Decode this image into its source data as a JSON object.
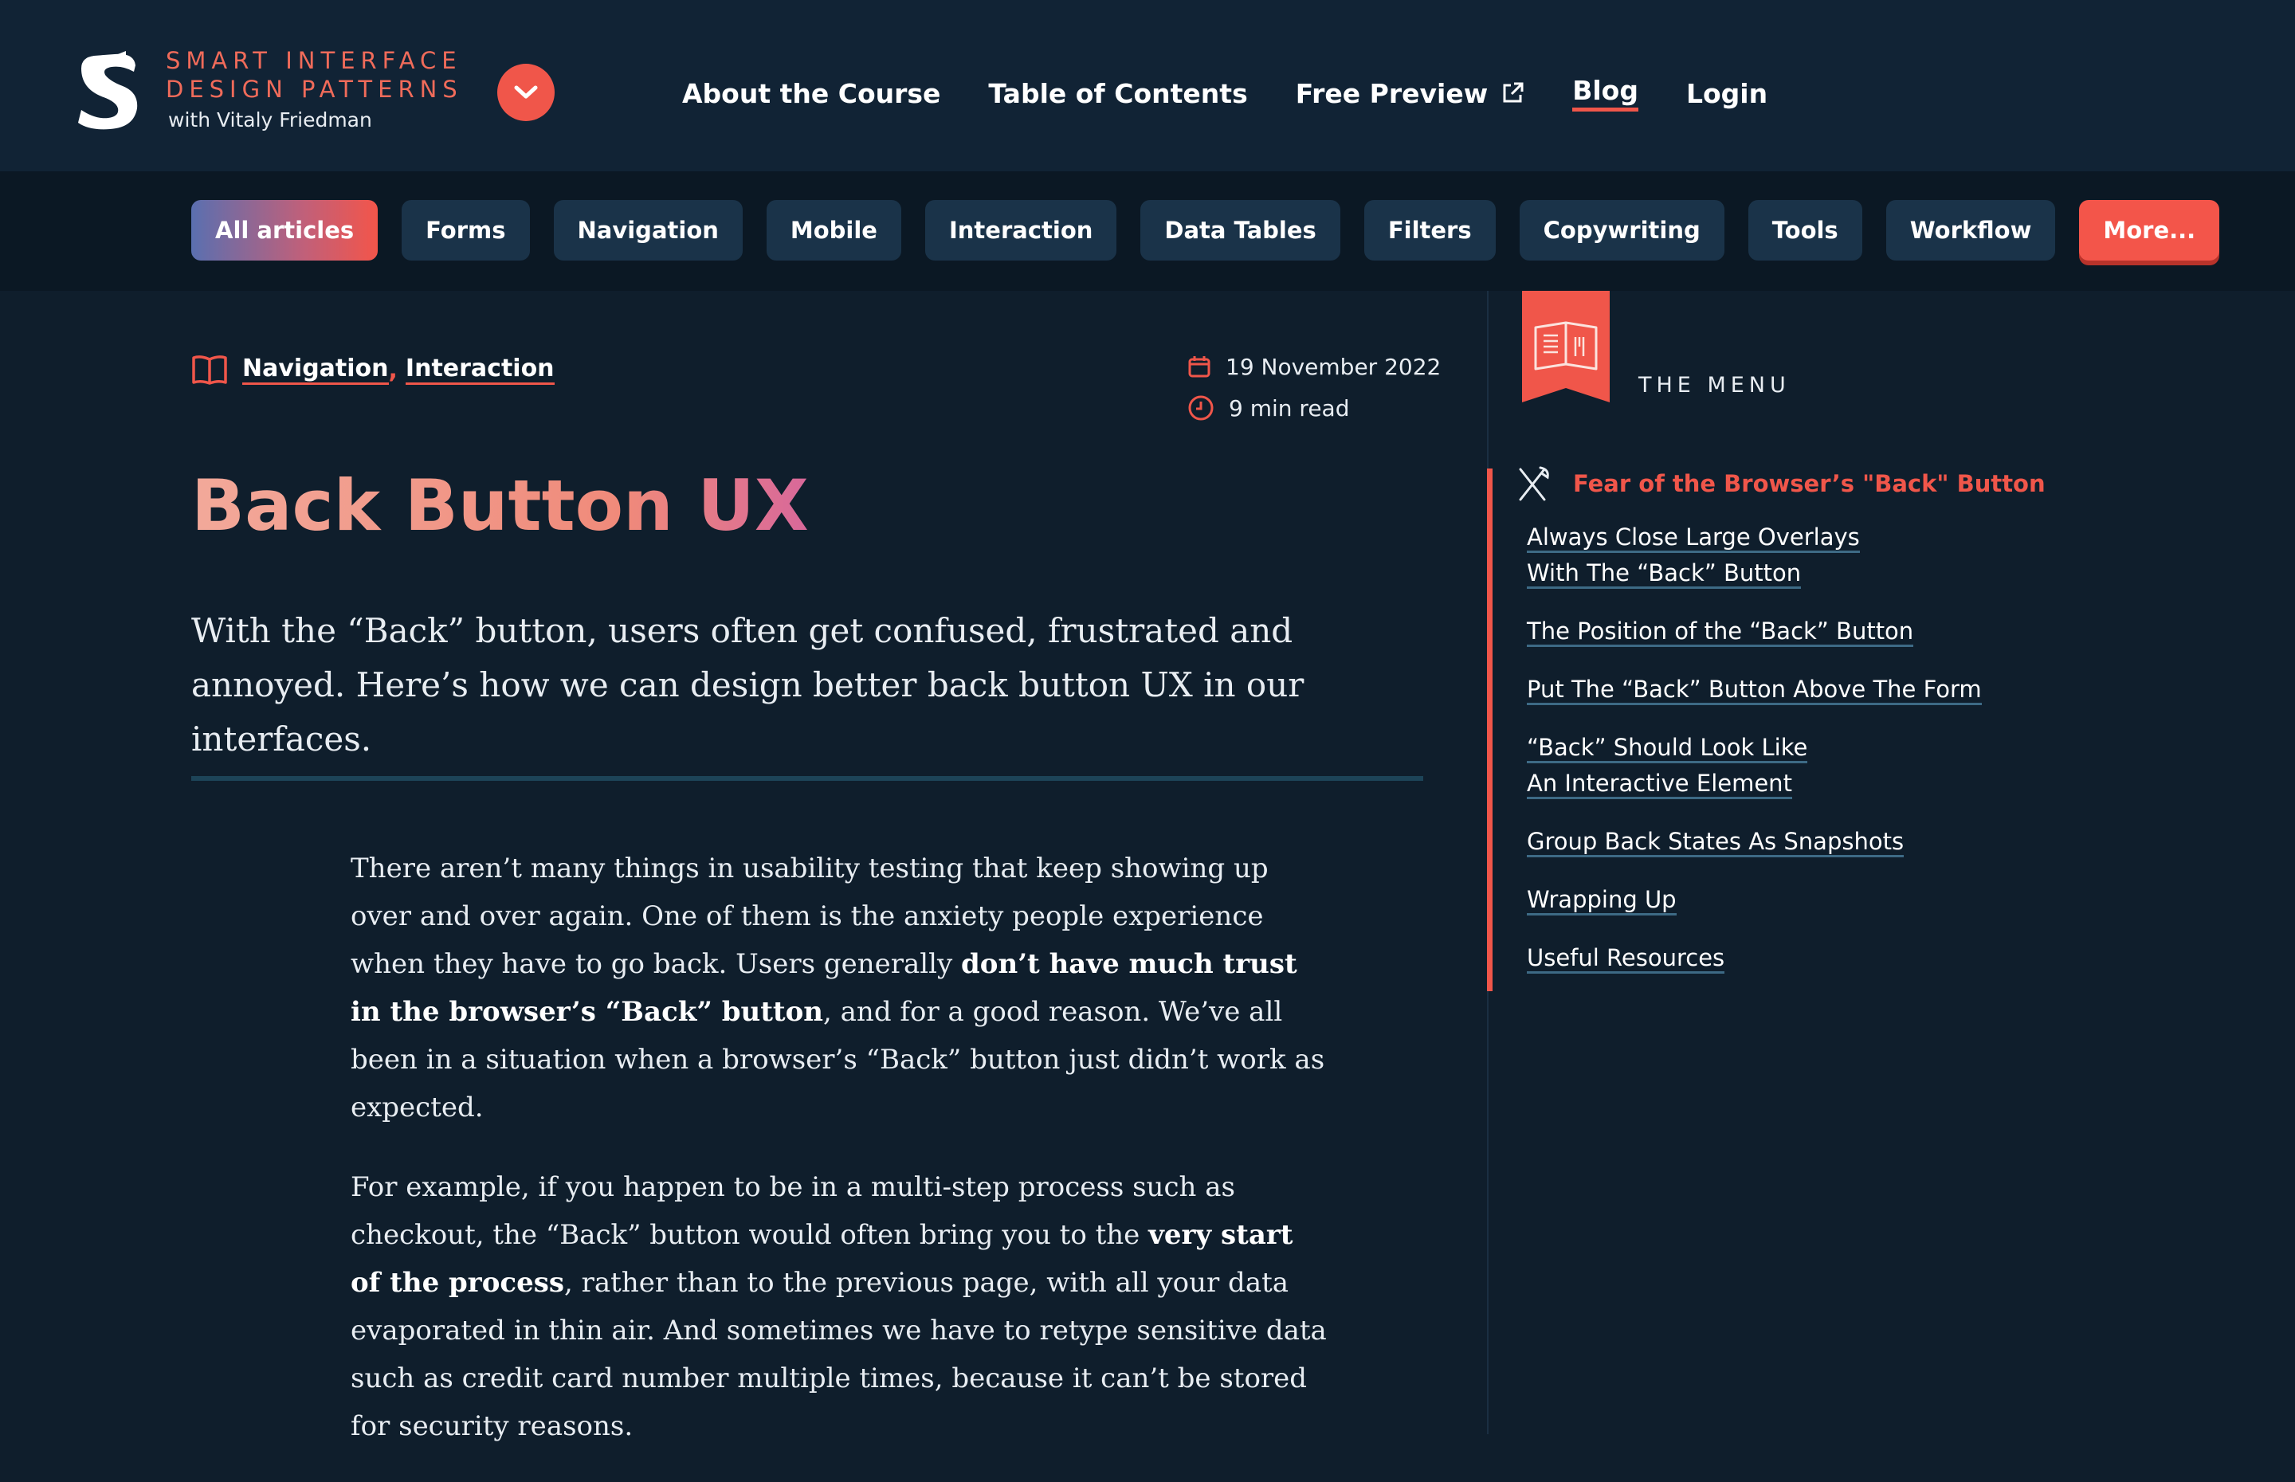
{
  "brand": {
    "line1": "SMART INTERFACE",
    "line2": "DESIGN PATTERNS",
    "byline": "with Vitaly Friedman"
  },
  "nav": {
    "items": [
      {
        "label": "About the Course"
      },
      {
        "label": "Table of Contents"
      },
      {
        "label": "Free Preview"
      },
      {
        "label": "Blog"
      },
      {
        "label": "Login"
      }
    ]
  },
  "tags": [
    {
      "label": "All articles"
    },
    {
      "label": "Forms"
    },
    {
      "label": "Navigation"
    },
    {
      "label": "Mobile"
    },
    {
      "label": "Interaction"
    },
    {
      "label": "Data Tables"
    },
    {
      "label": "Filters"
    },
    {
      "label": "Copywriting"
    },
    {
      "label": "Tools"
    },
    {
      "label": "Workflow"
    },
    {
      "label": "More..."
    }
  ],
  "article": {
    "categories": [
      {
        "label": "Navigation"
      },
      {
        "label": "Interaction"
      }
    ],
    "date": "19 November 2022",
    "read_time": "9 min read",
    "title": "Back Button UX",
    "lead": "With the “Back” button, users often get confused, frustrated and annoyed. Here’s how we can design better back button UX in our interfaces.",
    "p1": {
      "a": "There aren’t many things in usability testing that keep showing up over and over again. One of them is the anxiety people experience when they have to go back. Users generally ",
      "b": "don’t have much trust in the browser’s “Back” button",
      "c": ", and for a good reason. We’ve all been in a situation when a browser’s “Back” button just didn’t work as expected."
    },
    "p2": {
      "a": "For example, if you happen to be in a multi-step process such as checkout, the “Back” button would often bring you to the ",
      "b": "very start of the process",
      "c": ", rather than to the previous page, with all your data evaporated in thin air. And sometimes we have to retype sensitive data such as credit card number multiple times, because it can’t be stored for security reasons."
    }
  },
  "sidebar": {
    "menu_label": "THE MENU",
    "current": "Fear of the Browser’s \"Back\" Button",
    "items": [
      {
        "line1": "Always Close Large Overlays",
        "line2": "With The “Back” Button"
      },
      {
        "line1": "The Position of the “Back” Button",
        "line2": ""
      },
      {
        "line1": "Put The “Back” Button Above The Form",
        "line2": ""
      },
      {
        "line1": "“Back” Should Look Like",
        "line2": "An Interactive Element"
      },
      {
        "line1": "Group Back States As Snapshots",
        "line2": ""
      },
      {
        "line1": "Wrapping Up",
        "line2": ""
      },
      {
        "line1": "Useful Resources",
        "line2": ""
      }
    ]
  },
  "colors": {
    "background": "#0f1e2c",
    "accent": "#f0564a",
    "tag_bg": "#1a3349"
  },
  "icons": [
    "logo-s",
    "chevron-down-icon",
    "external-link-icon",
    "book-icon",
    "calendar-icon",
    "clock-icon",
    "menu-book-icon",
    "cutlery-icon"
  ]
}
